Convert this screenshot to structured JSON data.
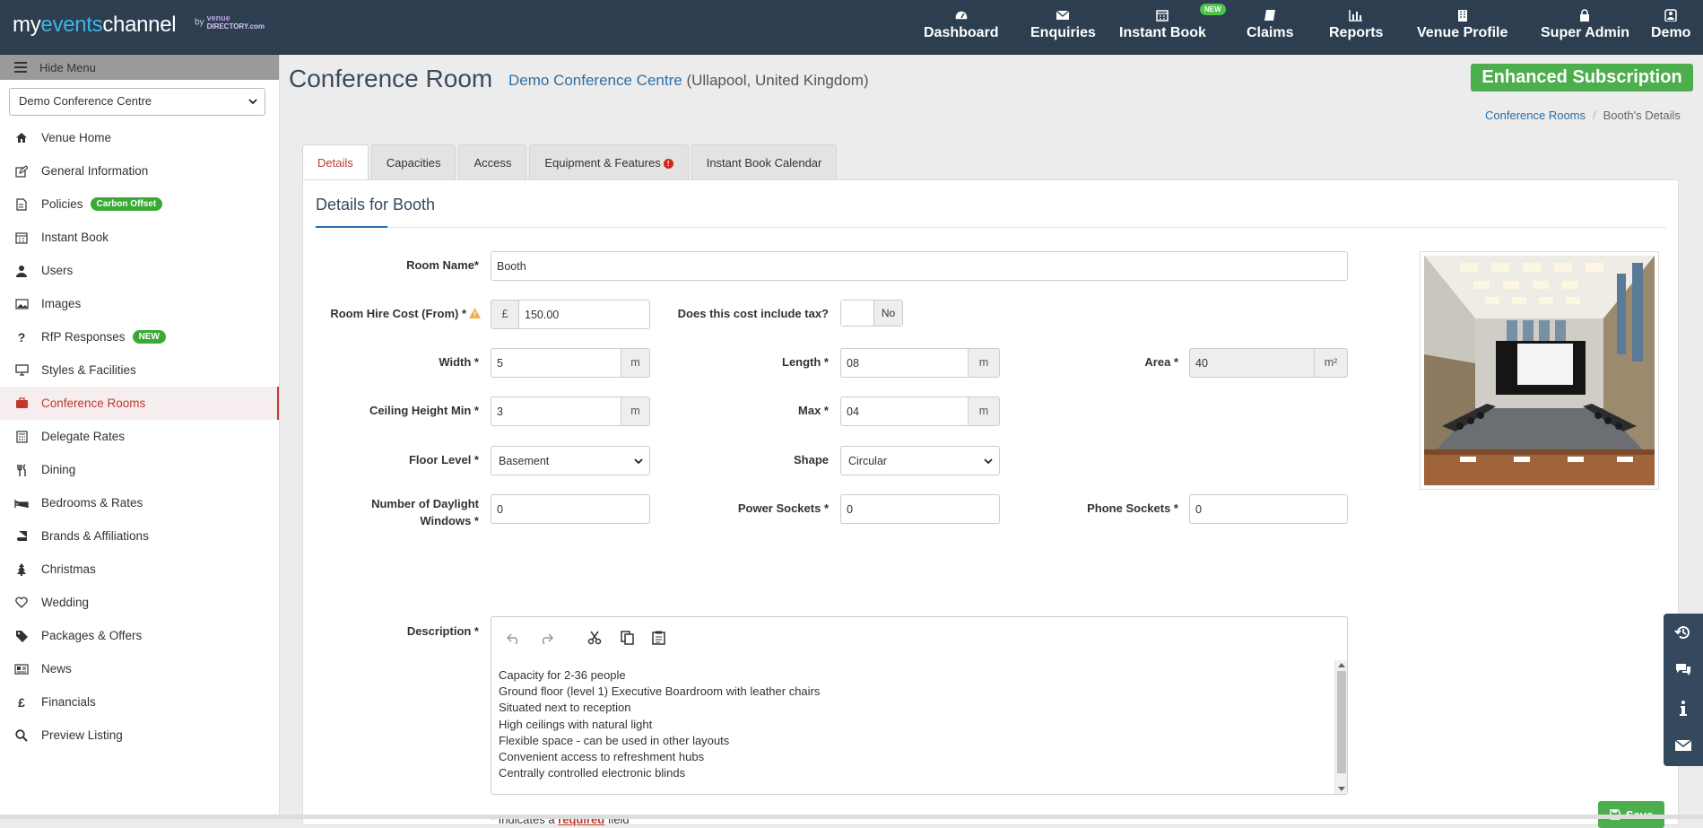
{
  "header": {
    "logo": {
      "my": "my",
      "events": "events",
      "channel": "channel",
      "by": "by",
      "brand_top": "venue",
      "brand_bottom": "DIRECTORY",
      "brand_suffix": ".com"
    },
    "nav": [
      {
        "label": "Dashboard",
        "icon": "dashboard-icon"
      },
      {
        "label": "Enquiries",
        "icon": "envelope-icon"
      },
      {
        "label": "Instant Book",
        "icon": "calendar-icon",
        "badge": "NEW"
      },
      {
        "label": "Claims",
        "icon": "book-icon"
      },
      {
        "label": "Reports",
        "icon": "bar-chart-icon"
      },
      {
        "label": "Venue Profile",
        "icon": "building-icon"
      },
      {
        "label": "Super Admin",
        "icon": "lock-icon"
      },
      {
        "label": "Demo",
        "icon": "user-icon"
      }
    ]
  },
  "sidebar": {
    "hide_label": "Hide Menu",
    "venue_select": "Demo Conference Centre",
    "items": [
      {
        "label": "Venue Home",
        "icon": "home-icon"
      },
      {
        "label": "General Information",
        "icon": "edit-icon"
      },
      {
        "label": "Policies",
        "icon": "document-icon",
        "pill": "Carbon Offset"
      },
      {
        "label": "Instant Book",
        "icon": "calendar-icon"
      },
      {
        "label": "Users",
        "icon": "user-icon"
      },
      {
        "label": "Images",
        "icon": "image-icon"
      },
      {
        "label": "RfP Responses",
        "icon": "question-icon",
        "pill": "NEW"
      },
      {
        "label": "Styles & Facilities",
        "icon": "monitor-icon"
      },
      {
        "label": "Conference Rooms",
        "icon": "briefcase-icon",
        "active": true
      },
      {
        "label": "Delegate Rates",
        "icon": "calculator-icon"
      },
      {
        "label": "Dining",
        "icon": "cutlery-icon"
      },
      {
        "label": "Bedrooms & Rates",
        "icon": "bed-icon"
      },
      {
        "label": "Brands & Affiliations",
        "icon": "book-icon"
      },
      {
        "label": "Christmas",
        "icon": "tree-icon"
      },
      {
        "label": "Wedding",
        "icon": "heart-icon"
      },
      {
        "label": "Packages & Offers",
        "icon": "tags-icon"
      },
      {
        "label": "News",
        "icon": "newspaper-icon"
      },
      {
        "label": "Financials",
        "icon": "pound-icon"
      },
      {
        "label": "Preview Listing",
        "icon": "search-icon"
      }
    ]
  },
  "page": {
    "title": "Conference Room",
    "venue_link": "Demo Conference Centre",
    "venue_location": "(Ullapool, United Kingdom)",
    "subscription": "Enhanced Subscription",
    "breadcrumb": {
      "link": "Conference Rooms",
      "sep": "/",
      "current": "Booth's Details"
    },
    "tabs": [
      "Details",
      "Capacities",
      "Access",
      "Equipment & Features",
      "Instant Book Calendar"
    ],
    "tab_warning": "!"
  },
  "form": {
    "heading": "Details for Booth",
    "room_name": {
      "label": "Room Name*",
      "value": "Booth"
    },
    "hire_cost": {
      "label": "Room Hire Cost (From) *",
      "currency": "£",
      "value": "150.00"
    },
    "tax": {
      "label": "Does this cost include tax?",
      "value": "No"
    },
    "width": {
      "label": "Width *",
      "value": "5",
      "unit": "m"
    },
    "length": {
      "label": "Length *",
      "value": "08",
      "unit": "m"
    },
    "area": {
      "label": "Area *",
      "value": "40",
      "unit": "m²"
    },
    "ceiling_min": {
      "label": "Ceiling Height Min *",
      "value": "3",
      "unit": "m"
    },
    "ceiling_max": {
      "label": "Max *",
      "value": "04",
      "unit": "m"
    },
    "floor_level": {
      "label": "Floor Level *",
      "value": "Basement"
    },
    "shape": {
      "label": "Shape",
      "value": "Circular"
    },
    "daylight": {
      "label_line1": "Number of Daylight",
      "label_line2": "Windows *",
      "value": "0"
    },
    "power": {
      "label": "Power Sockets *",
      "value": "0"
    },
    "phone": {
      "label": "Phone Sockets *",
      "value": "0"
    },
    "description": {
      "label": "Description *",
      "lines": [
        "Capacity for 2-36 people",
        "Ground floor (level 1) Executive Boardroom with leather chairs",
        "Situated next to reception",
        "High ceilings with natural light",
        "Flexible space - can be used in other layouts",
        "Convenient access to refreshment hubs",
        "Centrally controlled electronic blinds"
      ]
    },
    "required_note": {
      "prefix": "* Indicates a",
      "word": "required",
      "suffix": "field"
    },
    "save_label": "Save"
  },
  "colors": {
    "topbar": "#2c3e50",
    "accent_red": "#c0392b",
    "accent_green": "#4cae4c",
    "link_blue": "#2b6fa8"
  }
}
